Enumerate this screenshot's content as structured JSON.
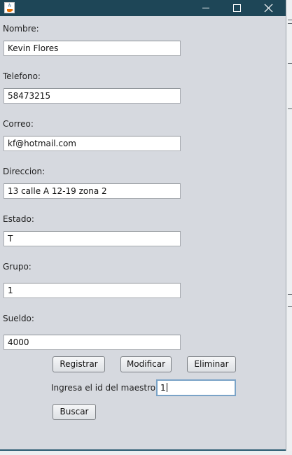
{
  "window": {
    "icon": "java-icon",
    "controls": [
      "minimize-icon",
      "maximize-icon",
      "close-icon"
    ]
  },
  "form": {
    "nombre": {
      "label": "Nombre:",
      "value": "Kevin Flores"
    },
    "telefono": {
      "label": "Telefono:",
      "value": "58473215"
    },
    "correo": {
      "label": "Correo:",
      "value": "kf@hotmail.com"
    },
    "direccion": {
      "label": "Direccion:",
      "value": "13 calle A 12-19 zona 2"
    },
    "estado": {
      "label": "Estado:",
      "value": "T"
    },
    "grupo": {
      "label": "Grupo:",
      "value": "1"
    },
    "sueldo": {
      "label": "Sueldo:",
      "value": "4000"
    }
  },
  "actions": {
    "registrar": "Registrar",
    "modificar": "Modificar",
    "eliminar": "Eliminar"
  },
  "search": {
    "label": "Ingresa el id del maestro:",
    "value": "1",
    "button": "Buscar"
  }
}
